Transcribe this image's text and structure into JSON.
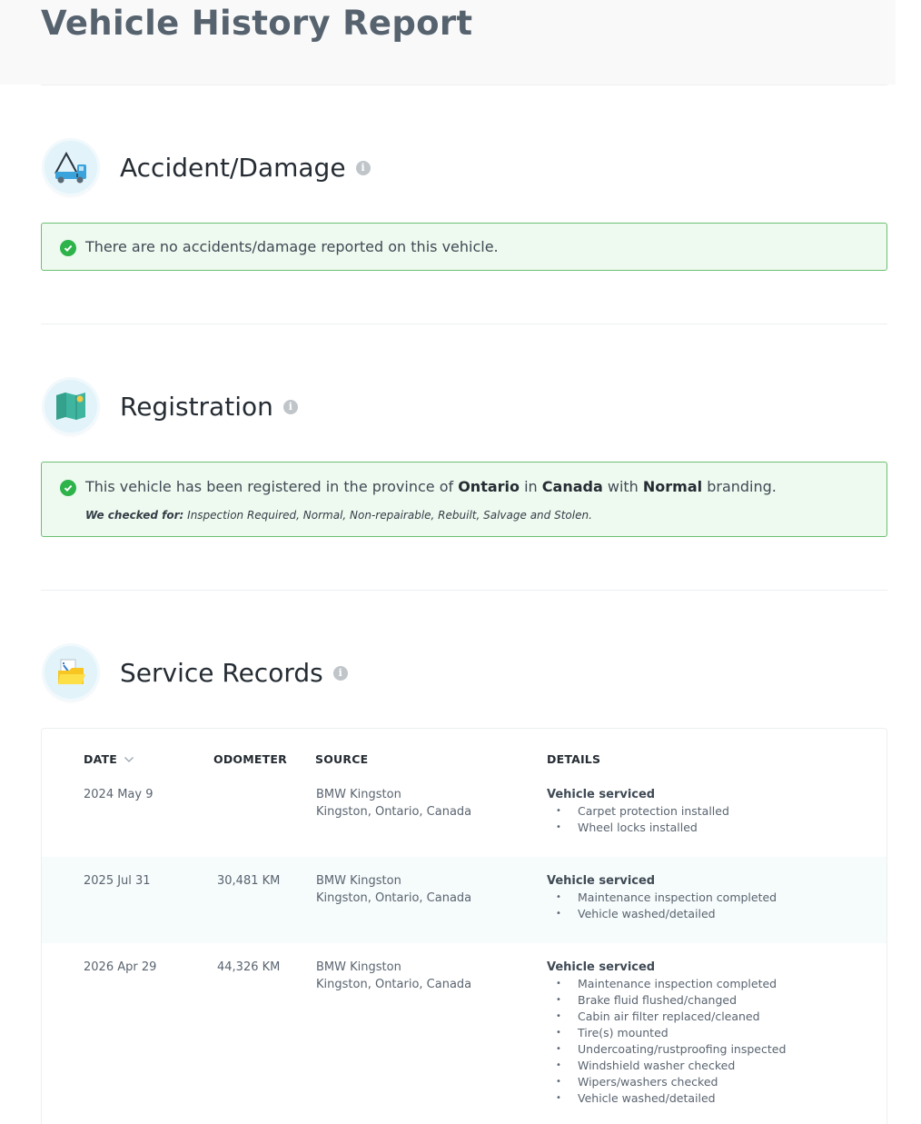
{
  "page": {
    "title": "Vehicle History Report"
  },
  "accident": {
    "title": "Accident/Damage",
    "icon": "tow-truck-icon",
    "message": "There are no accidents/damage reported on this vehicle."
  },
  "registration": {
    "title": "Registration",
    "icon": "map-icon",
    "msg_part1": "This vehicle has been registered in the province of ",
    "province": "Ontario",
    "msg_part2": " in ",
    "country": "Canada",
    "msg_part3": " with ",
    "branding": "Normal",
    "msg_part4": " branding.",
    "checked_label": "We checked for:",
    "checked_list": " Inspection Required, Normal, Non-repairable, Rebuilt, Salvage and Stolen."
  },
  "service": {
    "title": "Service Records",
    "icon": "folder-icon",
    "columns": {
      "date": "DATE",
      "odometer": "ODOMETER",
      "source": "SOURCE",
      "details": "DETAILS"
    },
    "sort_icon": "chevron-down-icon",
    "rows": [
      {
        "date": "2024 May 9",
        "odometer": "",
        "source_name": "BMW Kingston",
        "source_location": "Kingston, Ontario, Canada",
        "detail_title": "Vehicle serviced",
        "items": [
          "Carpet protection installed",
          "Wheel locks installed"
        ]
      },
      {
        "date": "2025 Jul 31",
        "odometer": "30,481 KM",
        "source_name": "BMW Kingston",
        "source_location": "Kingston, Ontario, Canada",
        "detail_title": "Vehicle serviced",
        "items": [
          "Maintenance inspection completed",
          "Vehicle washed/detailed"
        ]
      },
      {
        "date": "2026 Apr 29",
        "odometer": "44,326 KM",
        "source_name": "BMW Kingston",
        "source_location": "Kingston, Ontario, Canada",
        "detail_title": "Vehicle serviced",
        "items": [
          "Maintenance inspection completed",
          "Brake fluid flushed/changed",
          "Cabin air filter replaced/cleaned",
          "Tire(s) mounted",
          "Undercoating/rustproofing inspected",
          "Windshield washer checked",
          "Wipers/washers checked",
          "Vehicle washed/detailed"
        ]
      }
    ]
  },
  "colors": {
    "success_bg": "#eef9ef",
    "success_border": "#6bbf71",
    "check": "#2db34a",
    "title": "#56636f"
  }
}
